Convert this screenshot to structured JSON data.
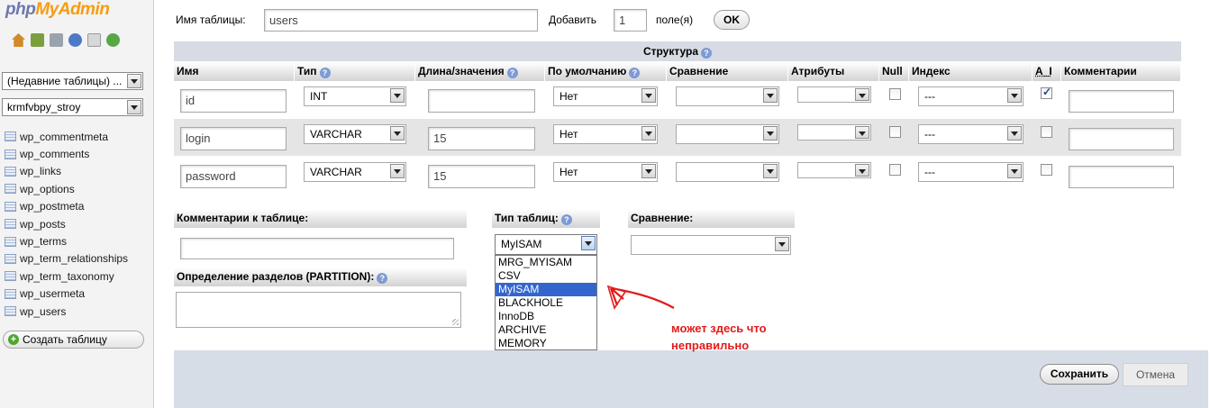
{
  "app": {
    "logo_part1": "php",
    "logo_part2": "MyAdmin"
  },
  "navigation": {
    "recent_tables": "(Недавние таблицы) ...",
    "database": "krmfvbpy_stroy",
    "tables": [
      "wp_commentmeta",
      "wp_comments",
      "wp_links",
      "wp_options",
      "wp_postmeta",
      "wp_posts",
      "wp_terms",
      "wp_term_relationships",
      "wp_term_taxonomy",
      "wp_usermeta",
      "wp_users"
    ],
    "create_table_label": "Создать таблицу"
  },
  "top_form": {
    "table_name_label": "Имя таблицы:",
    "table_name_value": "users",
    "add_label": "Добавить",
    "add_count": "1",
    "fields_label": "поле(я)",
    "ok_label": "OK"
  },
  "structure": {
    "title": "Структура",
    "columns": [
      "Имя",
      "Тип",
      "Длина/значения",
      "По умолчанию",
      "Сравнение",
      "Атрибуты",
      "Null",
      "Индекс",
      "A_I",
      "Комментарии"
    ],
    "rows": [
      {
        "name": "id",
        "type": "INT",
        "length": "",
        "default": "Нет",
        "collation": "",
        "attributes": "",
        "null": false,
        "index": "---",
        "ai": true,
        "comment": ""
      },
      {
        "name": "login",
        "type": "VARCHAR",
        "length": "15",
        "default": "Нет",
        "collation": "",
        "attributes": "",
        "null": false,
        "index": "---",
        "ai": false,
        "comment": ""
      },
      {
        "name": "password",
        "type": "VARCHAR",
        "length": "15",
        "default": "Нет",
        "collation": "",
        "attributes": "",
        "null": false,
        "index": "---",
        "ai": false,
        "comment": ""
      }
    ]
  },
  "table_options": {
    "comment_label": "Комментарии к таблице:",
    "comment_value": "",
    "engine_label": "Тип таблиц:",
    "engine_value": "MyISAM",
    "engine_options": [
      "MRG_MYISAM",
      "CSV",
      "MyISAM",
      "BLACKHOLE",
      "InnoDB",
      "ARCHIVE",
      "MEMORY"
    ],
    "engine_selected_index": 2,
    "collation_label": "Сравнение:",
    "collation_value": "",
    "partition_label": "Определение разделов (PARTITION):",
    "partition_value": ""
  },
  "annotation": {
    "line1": "может здесь что",
    "line2": "неправильно",
    "color": "#e21b1b"
  },
  "actions": {
    "save_label": "Сохранить",
    "cancel_label": "Отмена"
  },
  "colors": {
    "header_blue": "#d7dbe3",
    "selected_option": "#3366cc",
    "logo_php": "#6c78af",
    "logo_myadmin": "#f89c0e"
  }
}
